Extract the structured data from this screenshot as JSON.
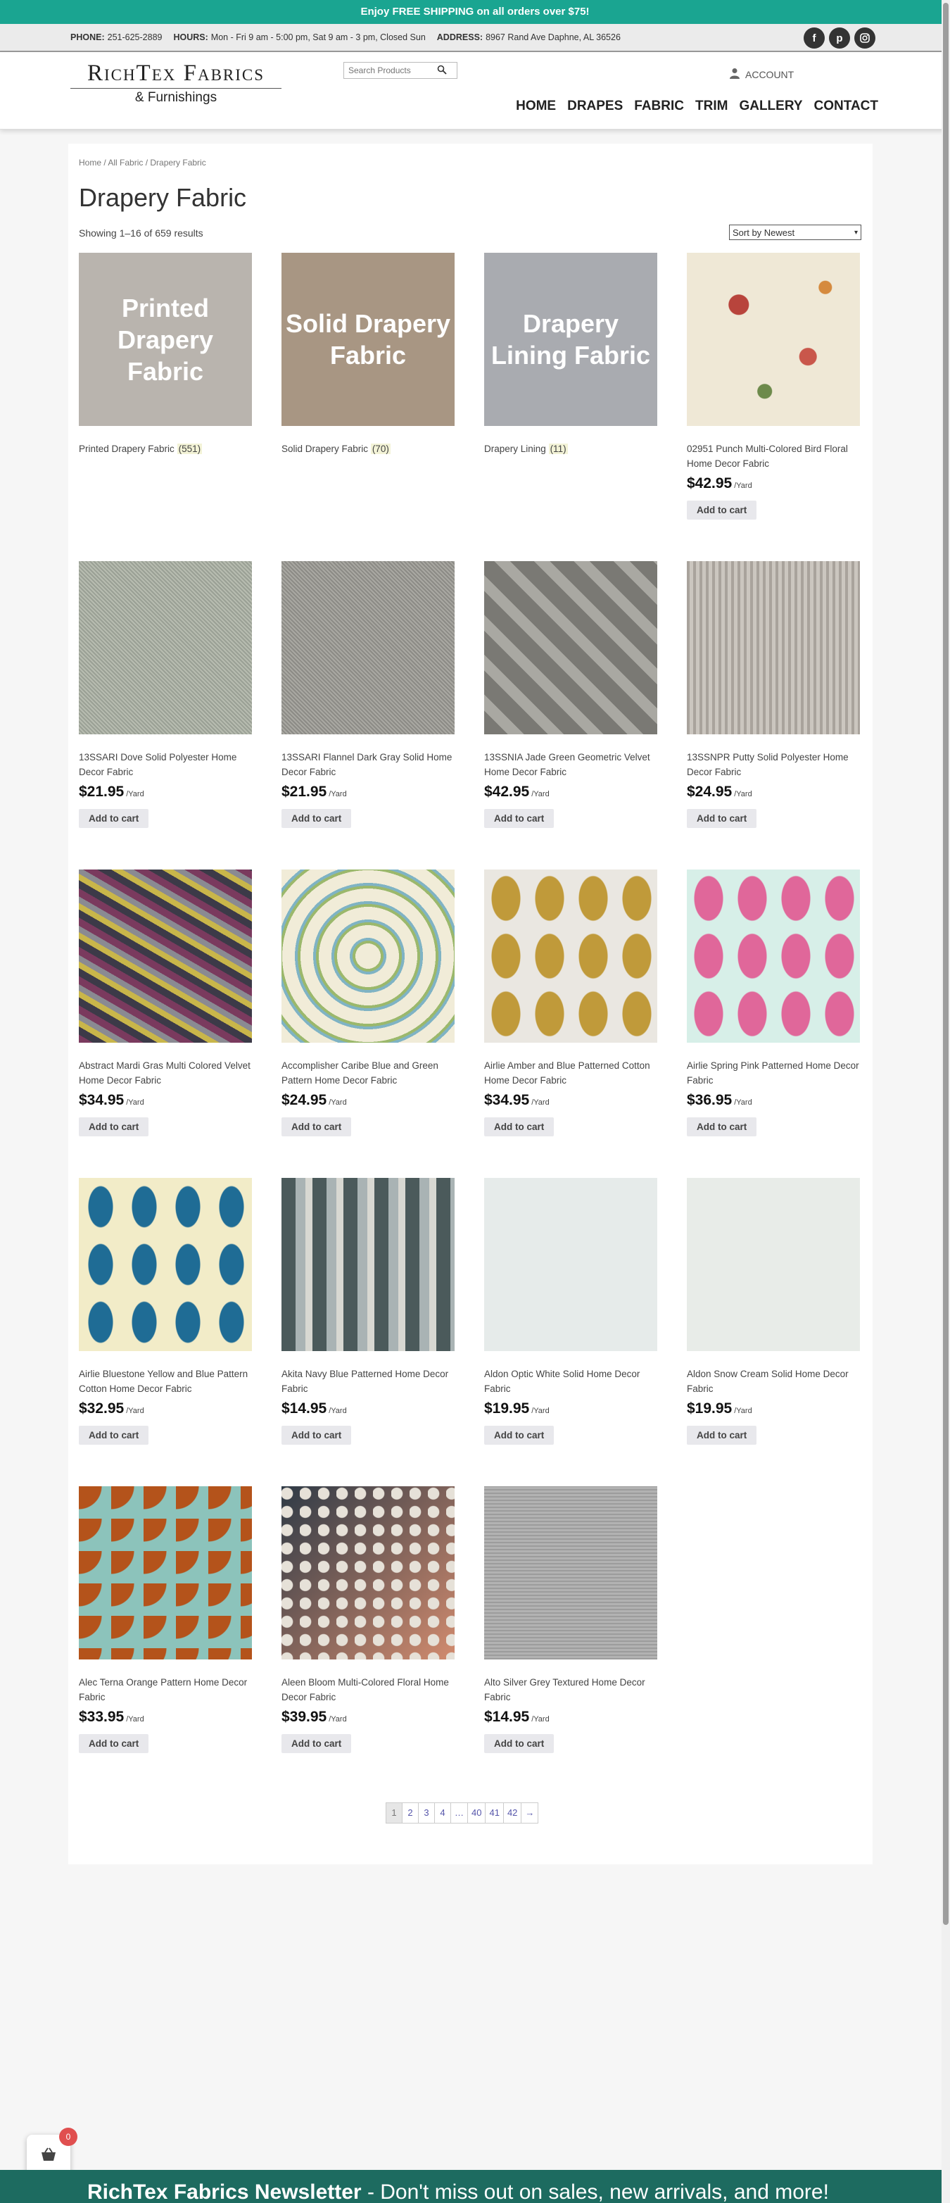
{
  "promo": "Enjoy FREE SHIPPING on all orders over $75!",
  "contact": {
    "phone_label": "PHONE:",
    "phone": "251-625-2889",
    "hours_label": "HOURS:",
    "hours": "Mon - Fri 9 am - 5:00 pm, Sat 9 am - 3 pm, Closed Sun",
    "address_label": "ADDRESS:",
    "address": "8967 Rand Ave Daphne, AL 36526"
  },
  "social": [
    "facebook-icon",
    "pinterest-icon",
    "instagram-icon"
  ],
  "header": {
    "logo_name": "RichTex Fabrics",
    "logo_sub": "& Furnishings",
    "search_placeholder": "Search Products",
    "account": "ACCOUNT",
    "nav": [
      "HOME",
      "DRAPES",
      "FABRIC",
      "TRIM",
      "GALLERY",
      "CONTACT"
    ]
  },
  "breadcrumb": "Home / All Fabric / Drapery Fabric",
  "title": "Drapery Fabric",
  "result_count": "Showing 1–16 of 659 results",
  "sort": "Sort by Newest",
  "unit": "/Yard",
  "add_to_cart": "Add to cart",
  "categories": [
    {
      "overlay": "Printed Drapery Fabric",
      "name": "Printed Drapery Fabric",
      "count": "(551)",
      "bg": "#b9b4ae"
    },
    {
      "overlay": "Solid Drapery Fabric",
      "name": "Solid Drapery Fabric",
      "count": "(70)",
      "bg": "#a89683"
    },
    {
      "overlay": "Drapery Lining Fabric",
      "name": "Drapery Lining",
      "count": "(11)",
      "bg": "#a9abb0"
    }
  ],
  "products": [
    {
      "name": "02951 Punch Multi-Colored Bird Floral Home Decor Fabric",
      "price": "$42.95",
      "swatch": "floral"
    },
    {
      "name": "13SSARI Dove Solid Polyester Home Decor Fabric",
      "price": "$21.95",
      "swatch": "dove"
    },
    {
      "name": "13SSARI Flannel Dark Gray Solid Home Decor Fabric",
      "price": "$21.95",
      "swatch": "flannel"
    },
    {
      "name": "13SSNIA Jade Green Geometric Velvet Home Decor Fabric",
      "price": "$42.95",
      "swatch": "jade"
    },
    {
      "name": "13SSNPR Putty Solid Polyester Home Decor Fabric",
      "price": "$24.95",
      "swatch": "putty"
    },
    {
      "name": "Abstract Mardi Gras Multi Colored Velvet Home Decor Fabric",
      "price": "$34.95",
      "swatch": "mardi"
    },
    {
      "name": "Accomplisher Caribe Blue and Green Pattern Home Decor Fabric",
      "price": "$24.95",
      "swatch": "caribe"
    },
    {
      "name": "Airlie Amber and Blue Patterned Cotton Home Decor Fabric",
      "price": "$34.95",
      "swatch": "amber"
    },
    {
      "name": "Airlie Spring Pink Patterned Home Decor Fabric",
      "price": "$36.95",
      "swatch": "pink"
    },
    {
      "name": "Airlie Bluestone Yellow and Blue Pattern Cotton Home Decor Fabric",
      "price": "$32.95",
      "swatch": "bluestone"
    },
    {
      "name": "Akita Navy Blue Patterned Home Decor Fabric",
      "price": "$14.95",
      "swatch": "akita"
    },
    {
      "name": "Aldon Optic White Solid Home Decor Fabric",
      "price": "$19.95",
      "swatch": "white"
    },
    {
      "name": "Aldon Snow Cream Solid Home Decor Fabric",
      "price": "$19.95",
      "swatch": "cream"
    },
    {
      "name": "Alec Terna Orange Pattern Home Decor Fabric",
      "price": "$33.95",
      "swatch": "orange"
    },
    {
      "name": "Aleen Bloom Multi-Colored Floral Home Decor Fabric",
      "price": "$39.95",
      "swatch": "bloom"
    },
    {
      "name": "Alto Silver Grey Textured Home Decor Fabric",
      "price": "$14.95",
      "swatch": "silver"
    }
  ],
  "pagination": [
    "1",
    "2",
    "3",
    "4",
    "…",
    "40",
    "41",
    "42",
    "→"
  ],
  "cart_count": "0",
  "newsletter_title": "RichTex Fabrics Newsletter",
  "newsletter_text": "- Don't miss out on sales, new arrivals, and more!"
}
